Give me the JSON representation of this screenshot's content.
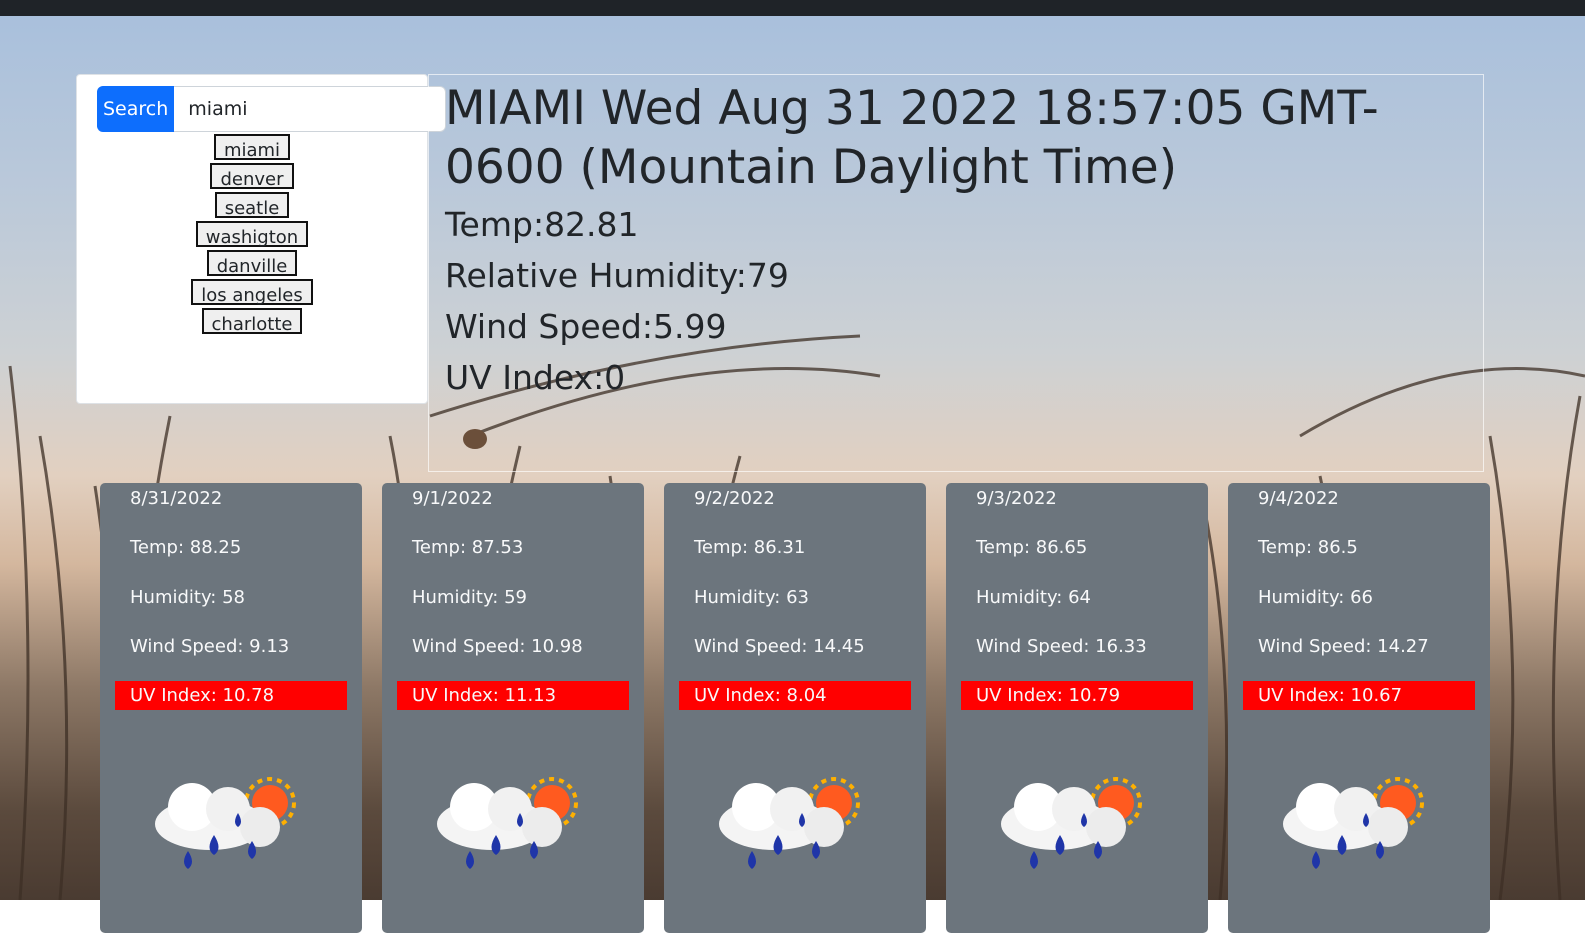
{
  "search": {
    "button_label": "Search",
    "input_value": "miami"
  },
  "history": [
    "miami",
    "denver",
    "seatle",
    "washigton",
    "danville",
    "los angeles",
    "charlotte"
  ],
  "current": {
    "title": "MIAMI Wed Aug 31 2022 18:57:05 GMT-0600 (Mountain Daylight Time)",
    "temp": "Temp:82.81",
    "humidity": "Relative Humidity:79",
    "wind": "Wind Speed:5.99",
    "uv": "UV Index:0"
  },
  "forecast": [
    {
      "date": "8/31/2022",
      "temp": "Temp: 88.25",
      "humidity": "Humidity: 58",
      "wind": "Wind Speed: 9.13",
      "uv": "UV Index: 10.78",
      "icon": "rain-sun-cloud-icon"
    },
    {
      "date": "9/1/2022",
      "temp": "Temp: 87.53",
      "humidity": "Humidity: 59",
      "wind": "Wind Speed: 10.98",
      "uv": "UV Index: 11.13",
      "icon": "rain-sun-cloud-icon"
    },
    {
      "date": "9/2/2022",
      "temp": "Temp: 86.31",
      "humidity": "Humidity: 63",
      "wind": "Wind Speed: 14.45",
      "uv": "UV Index: 8.04",
      "icon": "rain-sun-cloud-icon"
    },
    {
      "date": "9/3/2022",
      "temp": "Temp: 86.65",
      "humidity": "Humidity: 64",
      "wind": "Wind Speed: 16.33",
      "uv": "UV Index: 10.79",
      "icon": "rain-sun-cloud-icon"
    },
    {
      "date": "9/4/2022",
      "temp": "Temp: 86.5",
      "humidity": "Humidity: 66",
      "wind": "Wind Speed: 14.27",
      "uv": "UV Index: 10.67",
      "icon": "rain-sun-cloud-icon"
    }
  ],
  "colors": {
    "search_button": "#0d6efd",
    "card_bg": "#6c757d",
    "uv_high": "#ff0000"
  }
}
